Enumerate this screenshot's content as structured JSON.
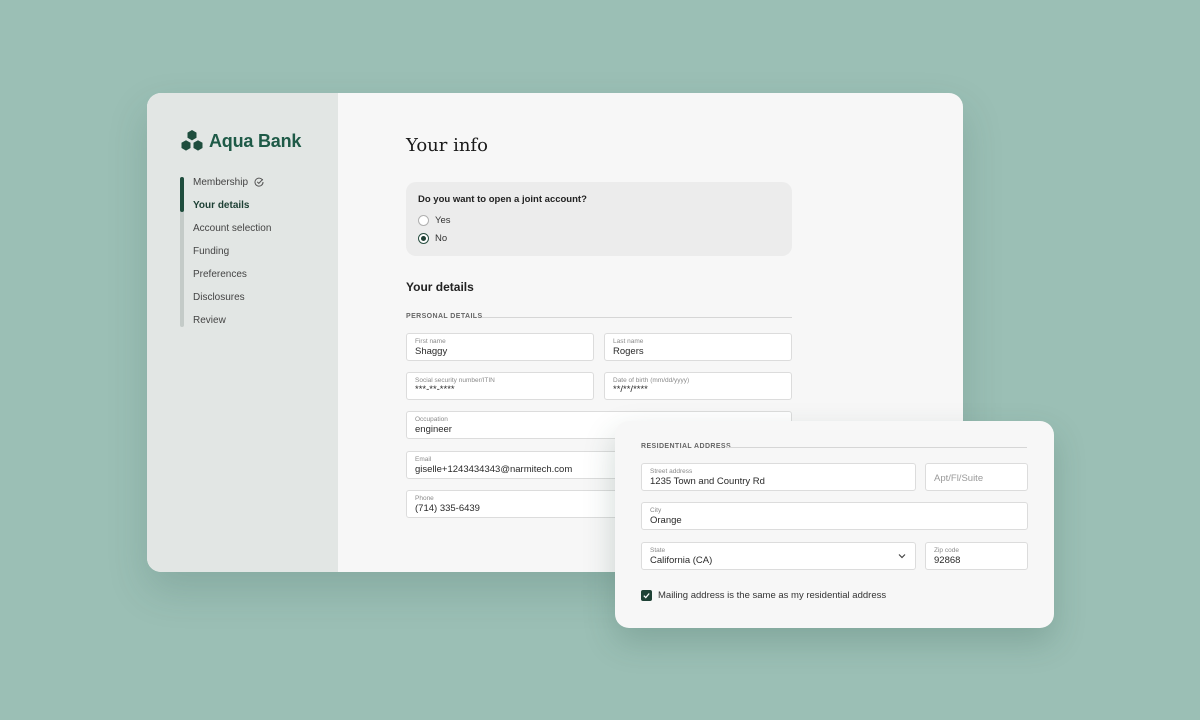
{
  "brand": {
    "name": "Aqua Bank",
    "color": "#1e5a47"
  },
  "steps": [
    {
      "label": "Membership",
      "completed": true
    },
    {
      "label": "Your details",
      "active": true
    },
    {
      "label": "Account selection"
    },
    {
      "label": "Funding"
    },
    {
      "label": "Preferences"
    },
    {
      "label": "Disclosures"
    },
    {
      "label": "Review"
    }
  ],
  "main": {
    "title": "Your info",
    "joint": {
      "question": "Do you want to open a joint account?",
      "options": [
        "Yes",
        "No"
      ],
      "selected": "No"
    },
    "details_heading": "Your details",
    "personal_label": "PERSONAL DETAILS",
    "fields": {
      "first_name": {
        "label": "First name",
        "value": "Shaggy"
      },
      "last_name": {
        "label": "Last name",
        "value": "Rogers"
      },
      "ssn": {
        "label": "Social security number/ITIN",
        "value": "***-**-****"
      },
      "dob": {
        "label": "Date of birth (mm/dd/yyyy)",
        "value": "**/**/****"
      },
      "occupation": {
        "label": "Occupation",
        "value": "engineer"
      },
      "email": {
        "label": "Email",
        "value": "giselle+1243434343@narmitech.com"
      },
      "phone": {
        "label": "Phone",
        "value": "(714) 335-6439"
      }
    }
  },
  "address": {
    "section_label": "RESIDENTIAL ADDRESS",
    "street": {
      "label": "Street address",
      "value": "1235 Town and Country Rd"
    },
    "apt": {
      "placeholder": "Apt/Fl/Suite"
    },
    "city": {
      "label": "City",
      "value": "Orange"
    },
    "state": {
      "label": "State",
      "value": "California (CA)"
    },
    "zip": {
      "label": "Zip code",
      "value": "92868"
    },
    "mailing_same": {
      "label": "Mailing address is the same as my residential address",
      "checked": true
    }
  }
}
